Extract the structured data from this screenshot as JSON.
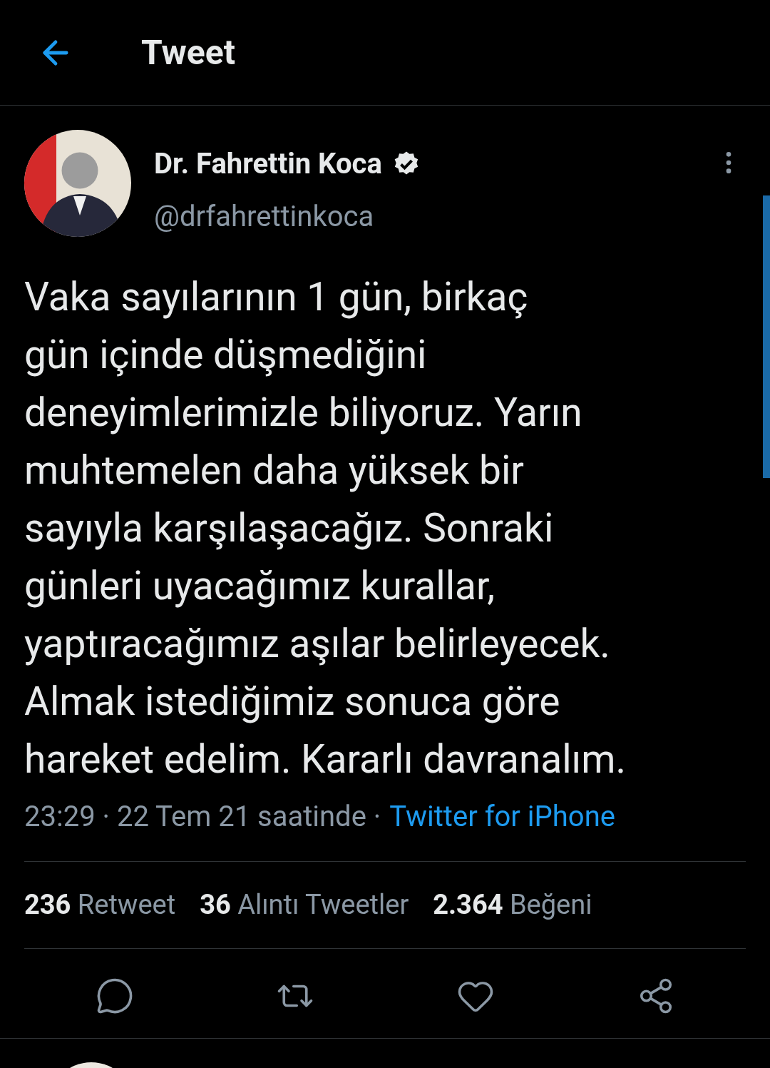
{
  "header": {
    "title": "Tweet"
  },
  "tweet": {
    "author": {
      "name": "Dr. Fahrettin Koca",
      "verified": true,
      "handle": "@drfahrettinkoca"
    },
    "text": "Vaka sayılarının 1 gün, birkaç\ngün içinde düşmediğini\ndeneyimlerimizle biliyoruz. Yarın\nmuhtemelen daha yüksek bir\nsayıyla karşılaşacağız. Sonraki\ngünleri uyacağımız kurallar,\nyaptıracağımız aşılar belirleyecek.\nAlmak istediğimiz sonuca göre\nhareket edelim. Kararlı davranalım.",
    "meta": "23:29 · 22 Tem 21 saatinde ·",
    "source": "Twitter for iPhone",
    "stats": [
      "**236** Retweet",
      "**36** Alıntı Tweetler",
      "**2.364** Beğeni"
    ],
    "actions": [
      {
        "kind": "reply"
      },
      {
        "kind": "retweet"
      },
      {
        "kind": "like"
      },
      {
        "kind": "share"
      }
    ]
  }
}
